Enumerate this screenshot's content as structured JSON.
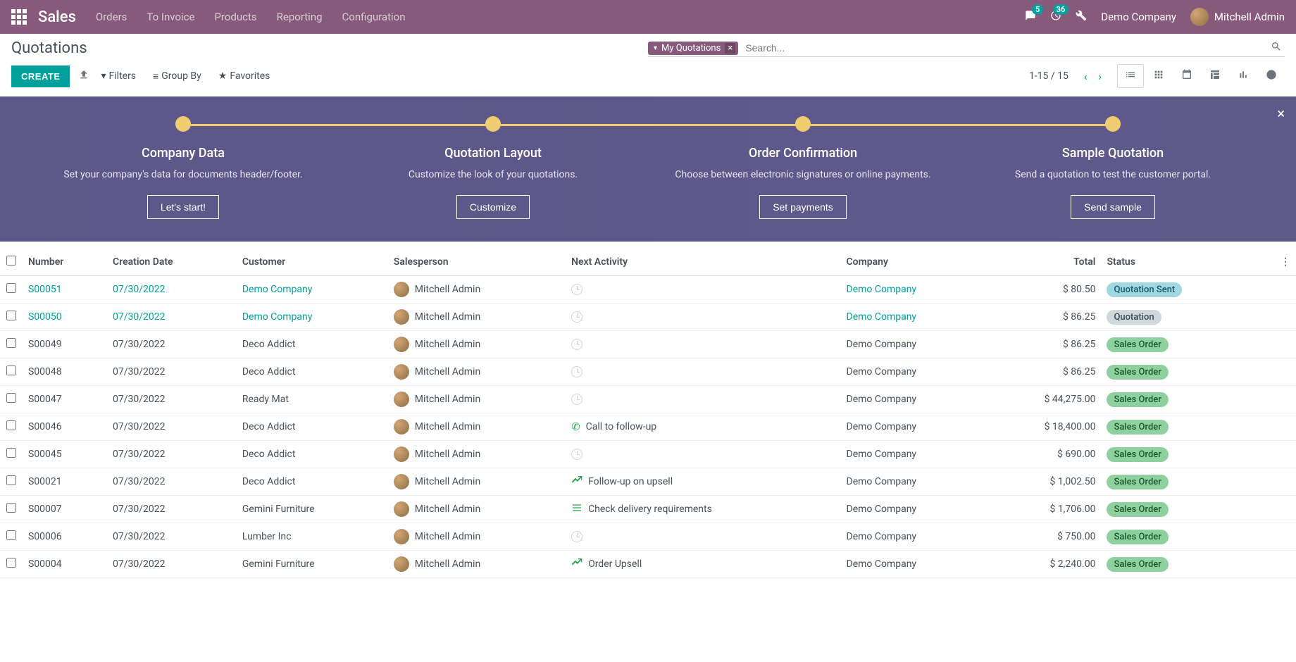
{
  "nav": {
    "app_name": "Sales",
    "links": [
      "Orders",
      "To Invoice",
      "Products",
      "Reporting",
      "Configuration"
    ],
    "chat_badge": "5",
    "activity_badge": "36",
    "company": "Demo Company",
    "user": "Mitchell Admin"
  },
  "cp": {
    "breadcrumb": "Quotations",
    "chip_label": "My Quotations",
    "search_placeholder": "Search...",
    "create": "CREATE",
    "filters": "Filters",
    "groupby": "Group By",
    "favorites": "Favorites",
    "pager": "1-15 / 15"
  },
  "banner": {
    "steps": [
      {
        "title": "Company Data",
        "desc": "Set your company's data for documents header/footer.",
        "button": "Let's start!"
      },
      {
        "title": "Quotation Layout",
        "desc": "Customize the look of your quotations.",
        "button": "Customize"
      },
      {
        "title": "Order Confirmation",
        "desc": "Choose between electronic signatures or online payments.",
        "button": "Set payments"
      },
      {
        "title": "Sample Quotation",
        "desc": "Send a quotation to test the customer portal.",
        "button": "Send sample"
      }
    ]
  },
  "table": {
    "headers": {
      "number": "Number",
      "date": "Creation Date",
      "customer": "Customer",
      "salesperson": "Salesperson",
      "activity": "Next Activity",
      "company": "Company",
      "total": "Total",
      "status": "Status"
    },
    "rows": [
      {
        "number": "S00051",
        "date": "07/30/2022",
        "customer": "Demo Company",
        "salesperson": "Mitchell Admin",
        "activity": "",
        "activity_icon": "clock",
        "company": "Demo Company",
        "total": "$ 80.50",
        "status": "Quotation Sent",
        "status_class": "badge-sent",
        "draft": true
      },
      {
        "number": "S00050",
        "date": "07/30/2022",
        "customer": "Demo Company",
        "salesperson": "Mitchell Admin",
        "activity": "",
        "activity_icon": "clock",
        "company": "Demo Company",
        "total": "$ 86.25",
        "status": "Quotation",
        "status_class": "badge-quote",
        "draft": true
      },
      {
        "number": "S00049",
        "date": "07/30/2022",
        "customer": "Deco Addict",
        "salesperson": "Mitchell Admin",
        "activity": "",
        "activity_icon": "clock",
        "company": "Demo Company",
        "total": "$ 86.25",
        "status": "Sales Order",
        "status_class": "badge-order",
        "draft": false
      },
      {
        "number": "S00048",
        "date": "07/30/2022",
        "customer": "Deco Addict",
        "salesperson": "Mitchell Admin",
        "activity": "",
        "activity_icon": "clock",
        "company": "Demo Company",
        "total": "$ 86.25",
        "status": "Sales Order",
        "status_class": "badge-order",
        "draft": false
      },
      {
        "number": "S00047",
        "date": "07/30/2022",
        "customer": "Ready Mat",
        "salesperson": "Mitchell Admin",
        "activity": "",
        "activity_icon": "clock",
        "company": "Demo Company",
        "total": "$ 44,275.00",
        "status": "Sales Order",
        "status_class": "badge-order",
        "draft": false
      },
      {
        "number": "S00046",
        "date": "07/30/2022",
        "customer": "Deco Addict",
        "salesperson": "Mitchell Admin",
        "activity": "Call to follow-up",
        "activity_icon": "phone",
        "company": "Demo Company",
        "total": "$ 18,400.00",
        "status": "Sales Order",
        "status_class": "badge-order",
        "draft": false
      },
      {
        "number": "S00045",
        "date": "07/30/2022",
        "customer": "Deco Addict",
        "salesperson": "Mitchell Admin",
        "activity": "",
        "activity_icon": "clock",
        "company": "Demo Company",
        "total": "$ 690.00",
        "status": "Sales Order",
        "status_class": "badge-order",
        "draft": false
      },
      {
        "number": "S00021",
        "date": "07/30/2022",
        "customer": "Deco Addict",
        "salesperson": "Mitchell Admin",
        "activity": "Follow-up on upsell",
        "activity_icon": "chart",
        "company": "Demo Company",
        "total": "$ 1,002.50",
        "status": "Sales Order",
        "status_class": "badge-order",
        "draft": false
      },
      {
        "number": "S00007",
        "date": "07/30/2022",
        "customer": "Gemini Furniture",
        "salesperson": "Mitchell Admin",
        "activity": "Check delivery requirements",
        "activity_icon": "list",
        "company": "Demo Company",
        "total": "$ 1,706.00",
        "status": "Sales Order",
        "status_class": "badge-order",
        "draft": false
      },
      {
        "number": "S00006",
        "date": "07/30/2022",
        "customer": "Lumber Inc",
        "salesperson": "Mitchell Admin",
        "activity": "",
        "activity_icon": "clock",
        "company": "Demo Company",
        "total": "$ 750.00",
        "status": "Sales Order",
        "status_class": "badge-order",
        "draft": false
      },
      {
        "number": "S00004",
        "date": "07/30/2022",
        "customer": "Gemini Furniture",
        "salesperson": "Mitchell Admin",
        "activity": "Order Upsell",
        "activity_icon": "chart",
        "company": "Demo Company",
        "total": "$ 2,240.00",
        "status": "Sales Order",
        "status_class": "badge-order",
        "draft": false
      }
    ]
  }
}
